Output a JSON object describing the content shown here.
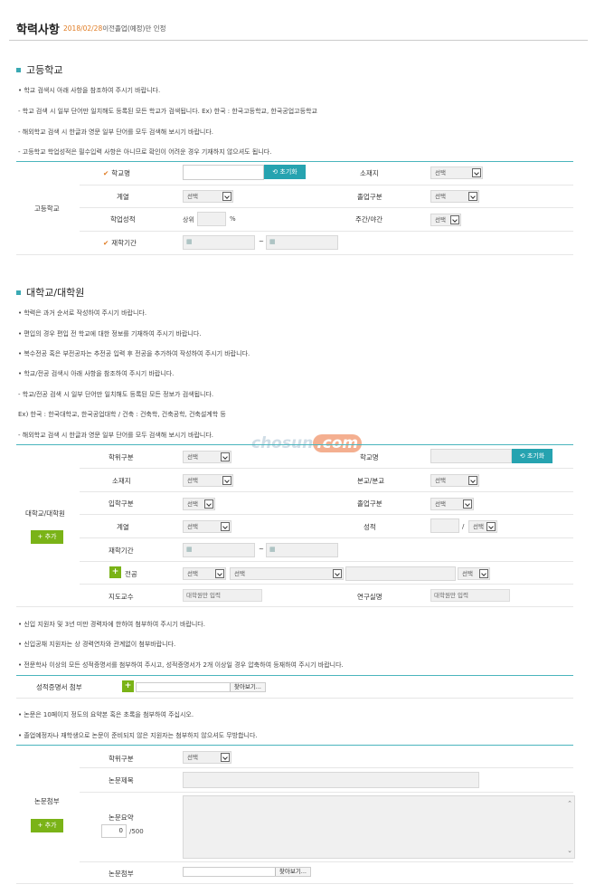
{
  "header": {
    "title": "학력사항",
    "date": "2018/02/28",
    "subtitle_rest": "이전졸업(예정)만 인정"
  },
  "high_school": {
    "section_title": "고등학교",
    "notes": [
      "• 학교 검색시 아래 사항을 참조하여 주시기 바랍니다.",
      "- 학교 검색 시 일부 단어만 일치해도 등록된 모든 학교가 검색됩니다. Ex) 한국 : 한국고등학교, 한국공업고등학교",
      "- 해외학교 검색 시 한글과 영문 일부 단어를 모두 검색해 보시기 바랍니다.",
      "- 고등학교 학업성적은 필수입력 사항은 아니므로 확인이 어려운 경우 기재하지 않으셔도 됩니다."
    ],
    "group_label": "고등학교",
    "school_name_label": "학교명",
    "reset_button": "초기화",
    "location_label": "소재지",
    "location_value": "선택",
    "track_label": "계열",
    "track_value": "선택",
    "graduation_label": "졸업구분",
    "graduation_value": "선택",
    "grade_label": "학업성적",
    "grade_prefix": "상위",
    "grade_unit": "%",
    "daynight_label": "주간/야간",
    "daynight_value": "선택",
    "period_label": "재학기간",
    "tilde": "~"
  },
  "university": {
    "section_title": "대학교/대학원",
    "notes": [
      "• 학력은 과거 순서로 작성하여 주시기 바랍니다.",
      "• 편입의 경우 편입 전 학교에 대한 정보를 기재하여 주시기 바랍니다.",
      "• 복수전공 혹은 부전공자는 추전공 입력 후 전공을 추가하여 작성하여 주시기 바랍니다.",
      "• 학교/전공 검색시 아래 사항을 참조하여 주시기 바랍니다.",
      "- 학교/전공 검색 시 일부 단어만 일치해도 등록된 모든 정보가 검색됩니다.",
      "Ex) 한국 : 한국대학교, 한국공업대학 / 건축 : 건축학, 건축공학, 건축설계학 등",
      "- 해외학교 검색 시 한글과 영문 일부 단어를 모두 검색해 보시기 바랍니다."
    ],
    "group_label": "대학교/대학원",
    "add_button": "추가",
    "degree_label": "학위구분",
    "degree_value": "선택",
    "school_name_label": "학교명",
    "reset_button": "초기화",
    "location_label": "소재지",
    "location_value": "선택",
    "campus_label": "본교/분교",
    "campus_value": "선택",
    "entrance_label": "입학구분",
    "entrance_value": "선택",
    "graduation_label": "졸업구분",
    "graduation_value": "선택",
    "track_label": "계열",
    "track_value": "선택",
    "gpa_label": "성적",
    "gpa_slash": "/",
    "gpa_scale_value": "선택",
    "period_label": "재학기간",
    "tilde": "~",
    "major_label": "전공",
    "major_sel1": "선택",
    "major_sel2": "선택",
    "major_sel3": "선택",
    "advisor_label": "지도교수",
    "advisor_placeholder": "대학원만 입력",
    "research_label": "연구실명",
    "research_placeholder": "대학원만 입력"
  },
  "transcript": {
    "notes": [
      "• 신입 지원자 및 3년 미만 경력자에 한하여 첨부하여 주시기 바랍니다.",
      "• 신입공채 지원자는 상 경력연차와 관계없이 첨부바랍니다.",
      "• 전문학사 이상의 모든 성적증명서를 첨부하여 주시고, 성적증명서가 2개 이상일 경우 압축하여 등재하여 주시기 바랍니다."
    ],
    "label": "성적증명서 첨부",
    "browse": "찾아보기..."
  },
  "thesis": {
    "notes": [
      "• 논문은 10페이지 정도의 요약본 혹은 초록을 첨부하여 주십시오.",
      "• 졸업예정자나 재학생으로 논문이 준비되지 않은 지원자는 첨부하지 않으셔도 무방합니다."
    ],
    "group_label": "논문첨부",
    "add_button": "추가",
    "degree_label": "학위구분",
    "degree_value": "선택",
    "title_label": "논문제목",
    "summary_label": "논문요약",
    "count_value": "0",
    "count_max": "/500",
    "attach_label": "논문첨부",
    "browse": "찾아보기..."
  },
  "watermark": {
    "text": "chosun",
    "dot": ".com"
  },
  "colors": {
    "accent": "#26a3b0",
    "green": "#7ab317",
    "orange": "#e07b22"
  }
}
